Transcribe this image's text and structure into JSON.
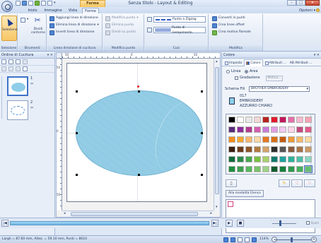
{
  "window": {
    "title": "Senza titolo - Layout & Editing",
    "contextual_group": "Forme",
    "min": "–",
    "max": "□",
    "close": "✕"
  },
  "ribbon_tabs": [
    "Inizio",
    "Immagine",
    "Vista",
    "Forme"
  ],
  "active_tab": "Forme",
  "options_label": "Opzioni",
  "groups": {
    "selezione": {
      "label": "Selezione",
      "btn_selection": "Selezione",
      "btn_divide": "Dividi contorno"
    },
    "strumenti": {
      "label": "Strumenti"
    },
    "linea_direzione": {
      "label": "Linea direzione di cucitura",
      "items": [
        "Aggiungi linea di direzione",
        "Elimina linea di direzione",
        "Inverti linea di direzione"
      ]
    },
    "modifica_punto": {
      "label": "Modifica punto",
      "items": [
        "Modifica punto",
        "Elimina punto",
        "Dividi su punto"
      ]
    },
    "cuci": {
      "label": "Cuci",
      "line_stitch": "Punto a Zigzag",
      "fill_stitch": "Punto di riempimento"
    },
    "modifica": {
      "label": "Modifica",
      "items": [
        "Converti in punti",
        "Crea linee offset",
        "Crea motivo floreale"
      ]
    }
  },
  "left_panel": {
    "title": "Ordine di Cucitura",
    "head_buttons": "▾ ✕",
    "items": [
      {
        "num": "1",
        "marks": "✂"
      },
      {
        "num": "2",
        "marks": "✂"
      }
    ]
  },
  "rulers": {
    "h": [
      "50",
      "0",
      "50"
    ],
    "v": [
      "50",
      "0",
      "50"
    ]
  },
  "right_panel": {
    "title": "Colore",
    "head_buttons": "▾ ✕",
    "tabs": [
      "Imposta",
      "Colore",
      "Attributi ...",
      "AB Attributi ..."
    ],
    "radio_line": "Linea",
    "radio_area": "Area",
    "gradient_label": "Gradazione",
    "motivo_button": "Motivo...",
    "schema_label": "Schema Fili",
    "schema_value": "BROTHER EMBROIDERY",
    "thread_number": "017",
    "thread_brand": "EMBROIDERY",
    "thread_name": "AZZURRO CHIARO",
    "palette_colors": [
      "#000000",
      "#ffffff",
      "#e8e8e8",
      "#f2d9d9",
      "#b5221f",
      "#e21a2c",
      "#c2185b",
      "#e46fa7",
      "#f9b8cf",
      "#f5a3b5",
      "#5b2b7a",
      "#8e2c9b",
      "#b23a8f",
      "#d45eae",
      "#c97bd6",
      "#e2a0e6",
      "#f0c9f0",
      "#ffd6ea",
      "#c34a7d",
      "#e05b8a",
      "#f28e1c",
      "#f7a733",
      "#f9b86c",
      "#fcd8a8",
      "#e87722",
      "#d96f15",
      "#c55b10",
      "#ef9a38",
      "#f4bb6a",
      "#f9d9a0",
      "#3a1e10",
      "#6b3a1b",
      "#8c5428",
      "#b07a3e",
      "#d4a46a",
      "#2f2f2f",
      "#555555",
      "#8a5a3c",
      "#a67449",
      "#c99a67",
      "#0f6b3b",
      "#2a8b4a",
      "#48a84f",
      "#7ac143",
      "#a7d16b",
      "#0f7a6c",
      "#20a39e",
      "#2db39a",
      "#4fc0a7",
      "#8dd6c2",
      "#1f8e3d",
      "#3da14e",
      "#57b85e",
      "#79c26b",
      "#9ed28a",
      "#0d5c2e",
      "#177f3d",
      "#2e9a4c",
      "#46b05d",
      "#63c070"
    ],
    "palette_selected": 59,
    "elenco_button": "Alla modalità Elenco"
  },
  "playback": {
    "start": "|◀",
    "end": "▶|",
    "play": "▶",
    "stop": "■",
    "loop_label": "Ripeti"
  },
  "statusbar": {
    "text": "Largh = 87.60 mm, Altez. = 59.10 mm, Punti = 8610",
    "zoom": "114%",
    "zoom_minus": "–",
    "zoom_plus": "+"
  },
  "accent": "#3e73c8",
  "shape_color": "#8fcde8"
}
